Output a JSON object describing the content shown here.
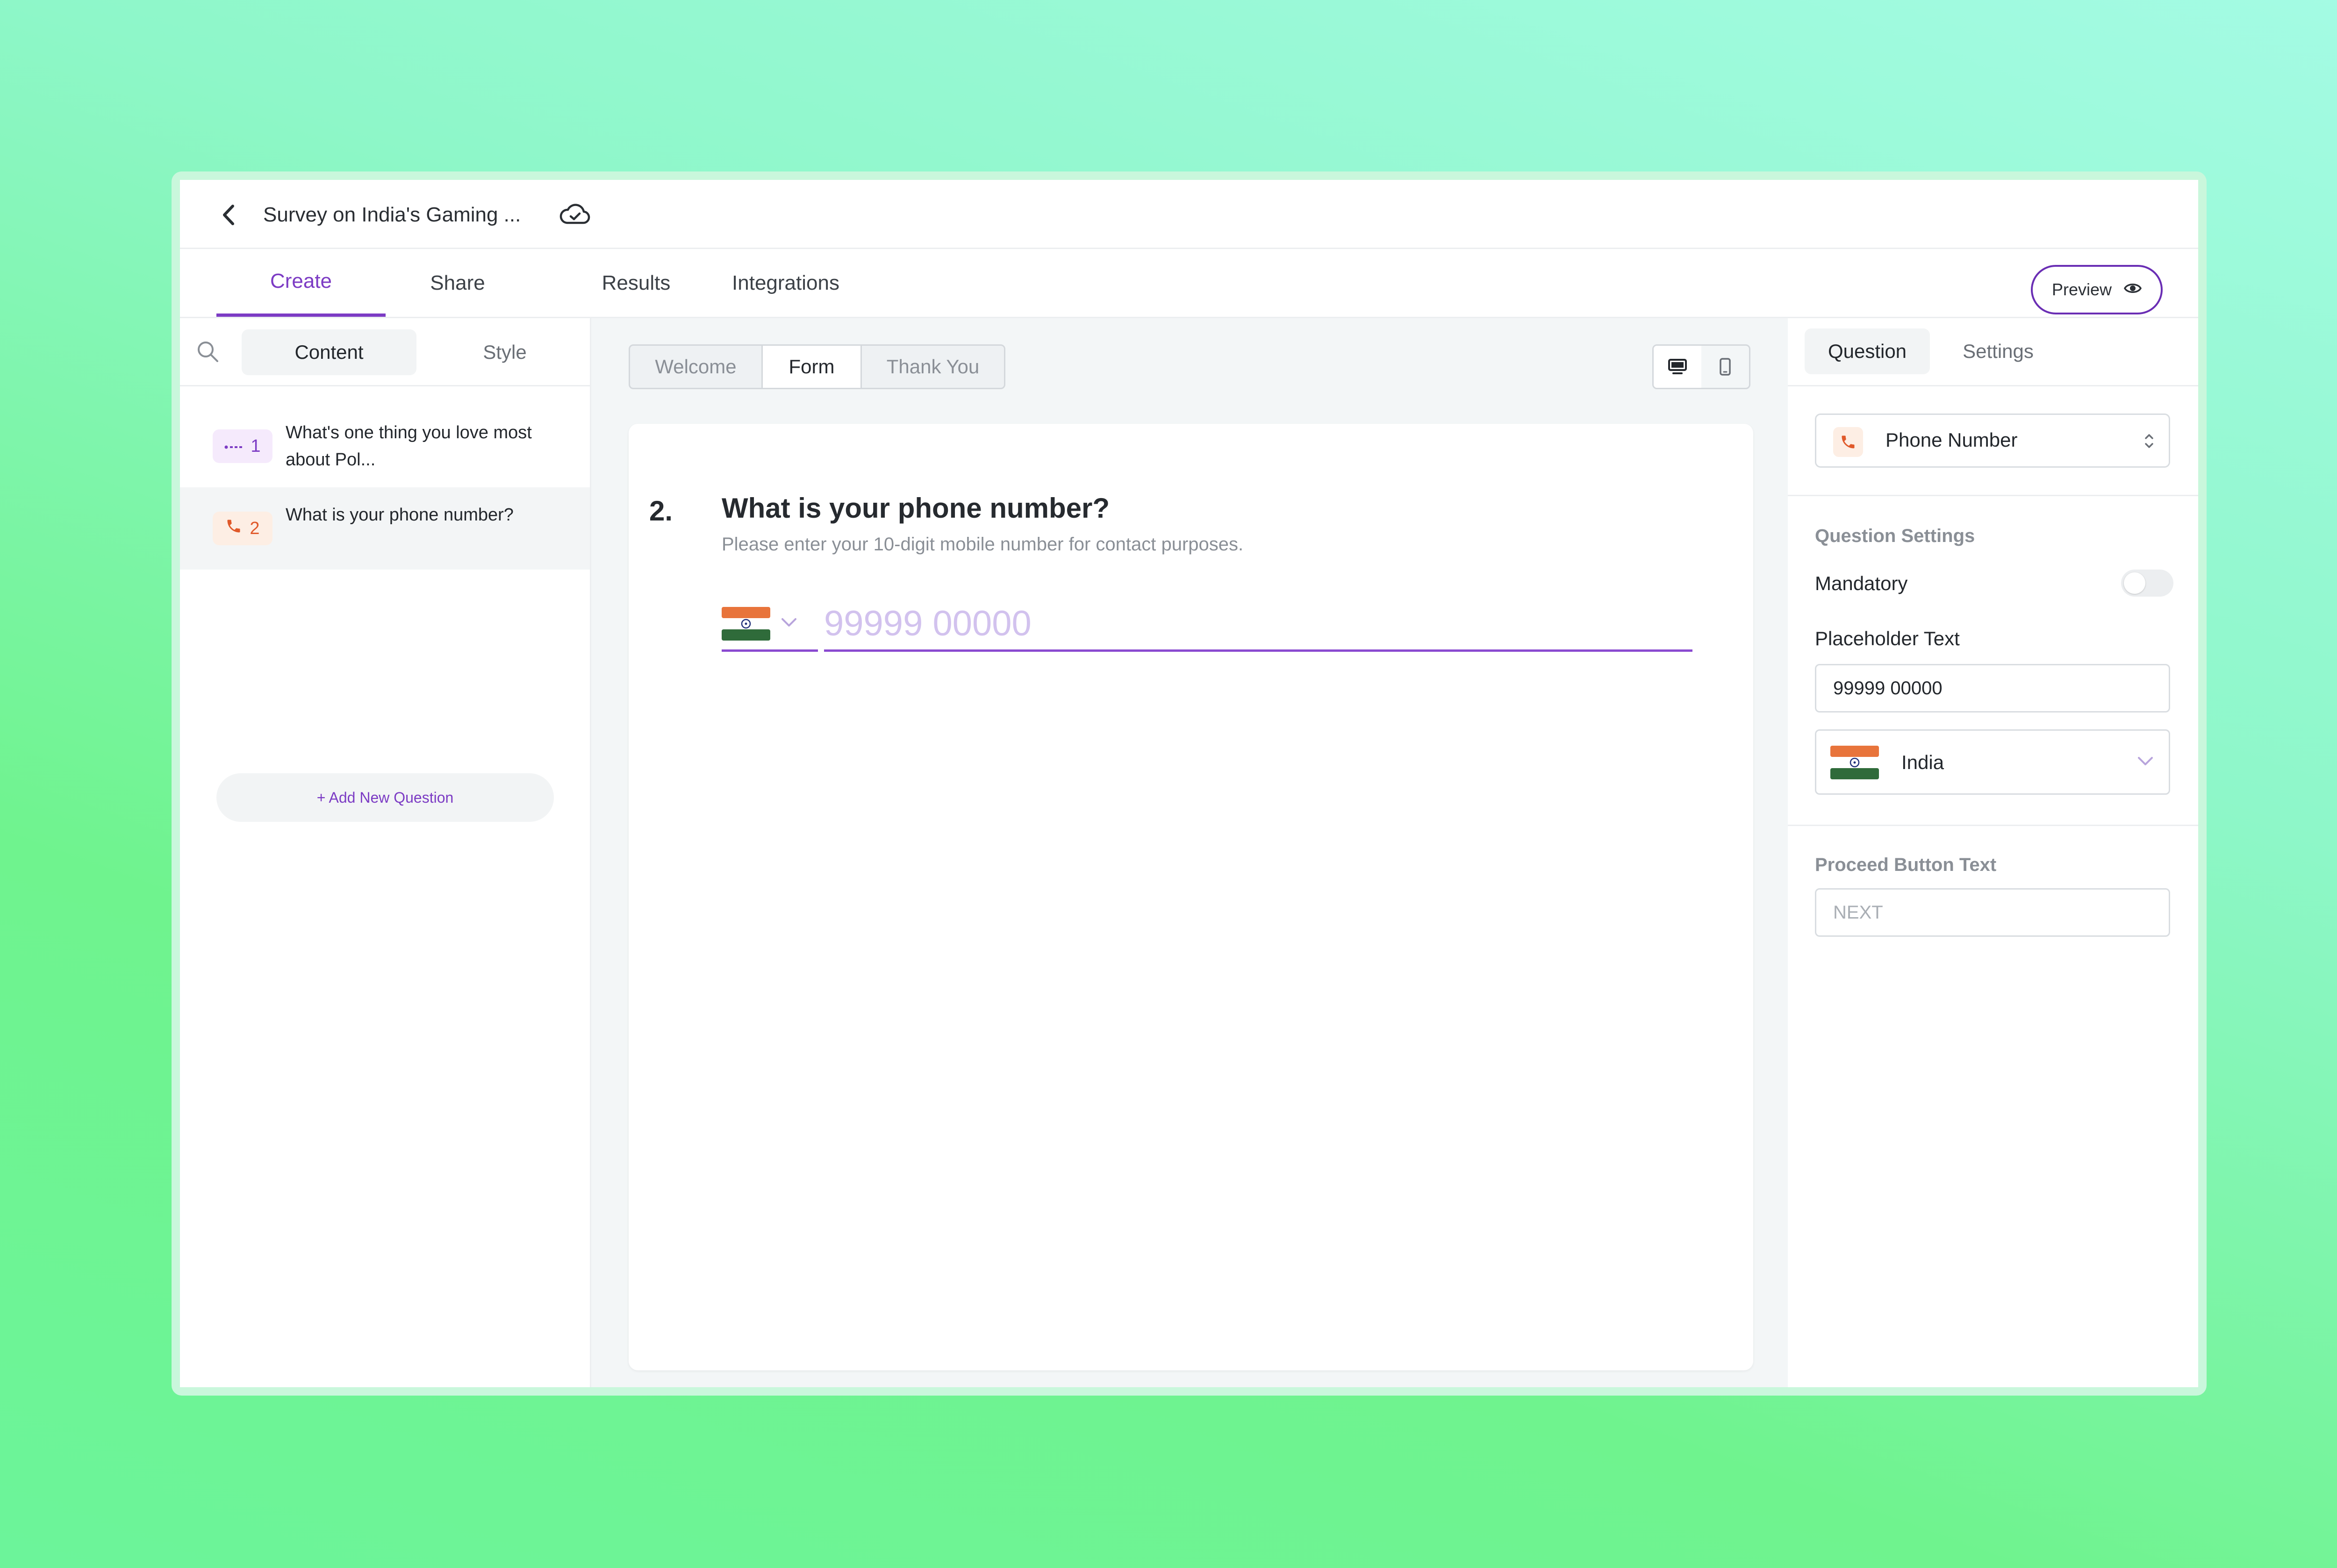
{
  "header": {
    "survey_title": "Survey on India's Gaming ..."
  },
  "nav": {
    "tabs": [
      {
        "label": "Create",
        "active": true
      },
      {
        "label": "Share",
        "active": false
      },
      {
        "label": "Results",
        "active": false
      },
      {
        "label": "Integrations",
        "active": false
      }
    ],
    "preview_label": "Preview"
  },
  "left_panel": {
    "tabs": [
      {
        "label": "Content",
        "active": true
      },
      {
        "label": "Style",
        "active": false
      }
    ],
    "questions": [
      {
        "number": "1",
        "icon": "list-icon",
        "text": "What's one thing you love most about Pol...",
        "selected": false
      },
      {
        "number": "2",
        "icon": "phone-icon",
        "text": "What is your phone number?",
        "selected": true
      }
    ],
    "add_question_label": "+ Add New Question"
  },
  "center": {
    "segments": [
      {
        "label": "Welcome",
        "active": false
      },
      {
        "label": "Form",
        "active": true
      },
      {
        "label": "Thank You",
        "active": false
      }
    ],
    "devices": [
      {
        "icon": "desktop-icon",
        "active": true
      },
      {
        "icon": "mobile-icon",
        "active": false
      }
    ],
    "question": {
      "number": "2.",
      "title": "What is your phone number?",
      "description": "Please enter your 10-digit mobile number for contact purposes.",
      "placeholder": "99999 00000",
      "country_flag": "india-flag-icon"
    }
  },
  "right_panel": {
    "tabs": [
      {
        "label": "Question",
        "active": true
      },
      {
        "label": "Settings",
        "active": false
      }
    ],
    "question_type": "Phone Number",
    "question_settings_heading": "Question Settings",
    "mandatory_label": "Mandatory",
    "mandatory_on": false,
    "placeholder_label": "Placeholder Text",
    "placeholder_value": "99999 00000",
    "country_value": "India",
    "proceed_heading": "Proceed Button Text",
    "proceed_placeholder": "NEXT"
  },
  "colors": {
    "accent": "#7c3bc4",
    "phone_icon": "#e0592a",
    "list_badge_bg": "#f5eafc",
    "phone_badge_bg": "#fdeee4",
    "background_gradient_start": "#a4fbe4",
    "background_gradient_end": "#6ff38e"
  }
}
